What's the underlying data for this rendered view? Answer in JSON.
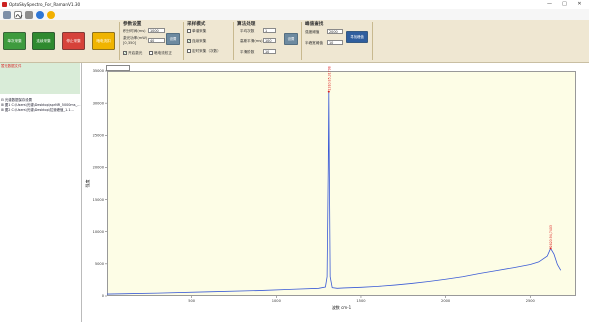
{
  "window": {
    "title": "OptoSkySpectro_For_RamanV1.30",
    "controls": [
      "—",
      "□",
      "✕"
    ]
  },
  "quick_toolbar": [
    "open-icon",
    "wave-icon",
    "save-icon",
    "info-icon",
    "undo-icon"
  ],
  "ribbon": {
    "buttons": [
      {
        "label": "单次采集",
        "color": "#3e9b3e"
      },
      {
        "label": "连续采集",
        "color": "#2f8a2f"
      },
      {
        "label": "停止采集",
        "color": "#d6423a"
      },
      {
        "label": "暗电流扣",
        "color": "#f0b400"
      }
    ],
    "params": {
      "title": "参数设置",
      "integration_label": "积分时间(ms)",
      "integration_value": "1000",
      "laser_label": "激光功率(mW)",
      "laser_sub": "[0,350]",
      "laser_value": "40",
      "set_button": "设置",
      "autosave_label": "开启激光",
      "opt2_label": "暗电流校正"
    },
    "mode": {
      "title": "采样模式",
      "opt1": "单谱采集",
      "opt2": "连续采集",
      "opt3": "定时采集（次数）",
      "opt2_checked": "✓"
    },
    "processing": {
      "title": "算法处理",
      "avg_label": "平均次数",
      "avg_value": "1",
      "smooth_label": "高斯平滑(ms)",
      "smooth_value": "100",
      "baseline_label": "平滑阶数",
      "baseline_value": "10",
      "set_button": "设置"
    },
    "peak": {
      "title": "峰值查找",
      "threshold_label": "强度阈值",
      "threshold_value": "2000",
      "width_label": "半峰宽阈值",
      "width_value": "10",
      "find_button": "寻找峰值"
    }
  },
  "left_panel": {
    "status_text": "暂无数据文件",
    "tree": [
      "⊟ 光谱数据保存设置",
      "   ⊞ 图1 C:\\Users\\光谱\\Desktop\\sprNR_5000ms_…",
      "   ⊞ 图2 C:\\Users\\光谱\\Desktop\\拉曼峰值_1.1…"
    ]
  },
  "chart_data": {
    "type": "line",
    "xlabel": "波数 cm-1",
    "ylabel": "强度",
    "xlim": [
      0,
      2770
    ],
    "ylim": [
      0,
      35000
    ],
    "xticks": [
      500,
      1000,
      1500,
      2000,
      2500
    ],
    "yticks": [
      0,
      5000,
      10000,
      15000,
      20000,
      25000,
      30000,
      35000
    ],
    "color": "#3b5bd6",
    "series": [
      {
        "x": [
          0,
          300,
          600,
          900,
          1100,
          1250,
          1290,
          1300,
          1307,
          1310,
          1313,
          1318,
          1330,
          1360,
          1400,
          1500,
          1600,
          1700,
          1800,
          1900,
          2000,
          2100,
          2200,
          2300,
          2400,
          2500,
          2550,
          2600,
          2620,
          2640,
          2660,
          2680
        ],
        "y": [
          300,
          450,
          650,
          850,
          1050,
          1200,
          1400,
          3000,
          20000,
          31800,
          20000,
          3000,
          1300,
          1200,
          1250,
          1350,
          1500,
          1700,
          1950,
          2250,
          2600,
          3000,
          3500,
          3950,
          4400,
          4900,
          5300,
          6200,
          7400,
          6500,
          4900,
          4000
        ]
      }
    ],
    "annotations": [
      {
        "text": "1310.85,31798",
        "x": 1310,
        "y": 31800
      },
      {
        "text": "2620.94,7403",
        "x": 2620,
        "y": 7400
      }
    ],
    "grid": false
  }
}
